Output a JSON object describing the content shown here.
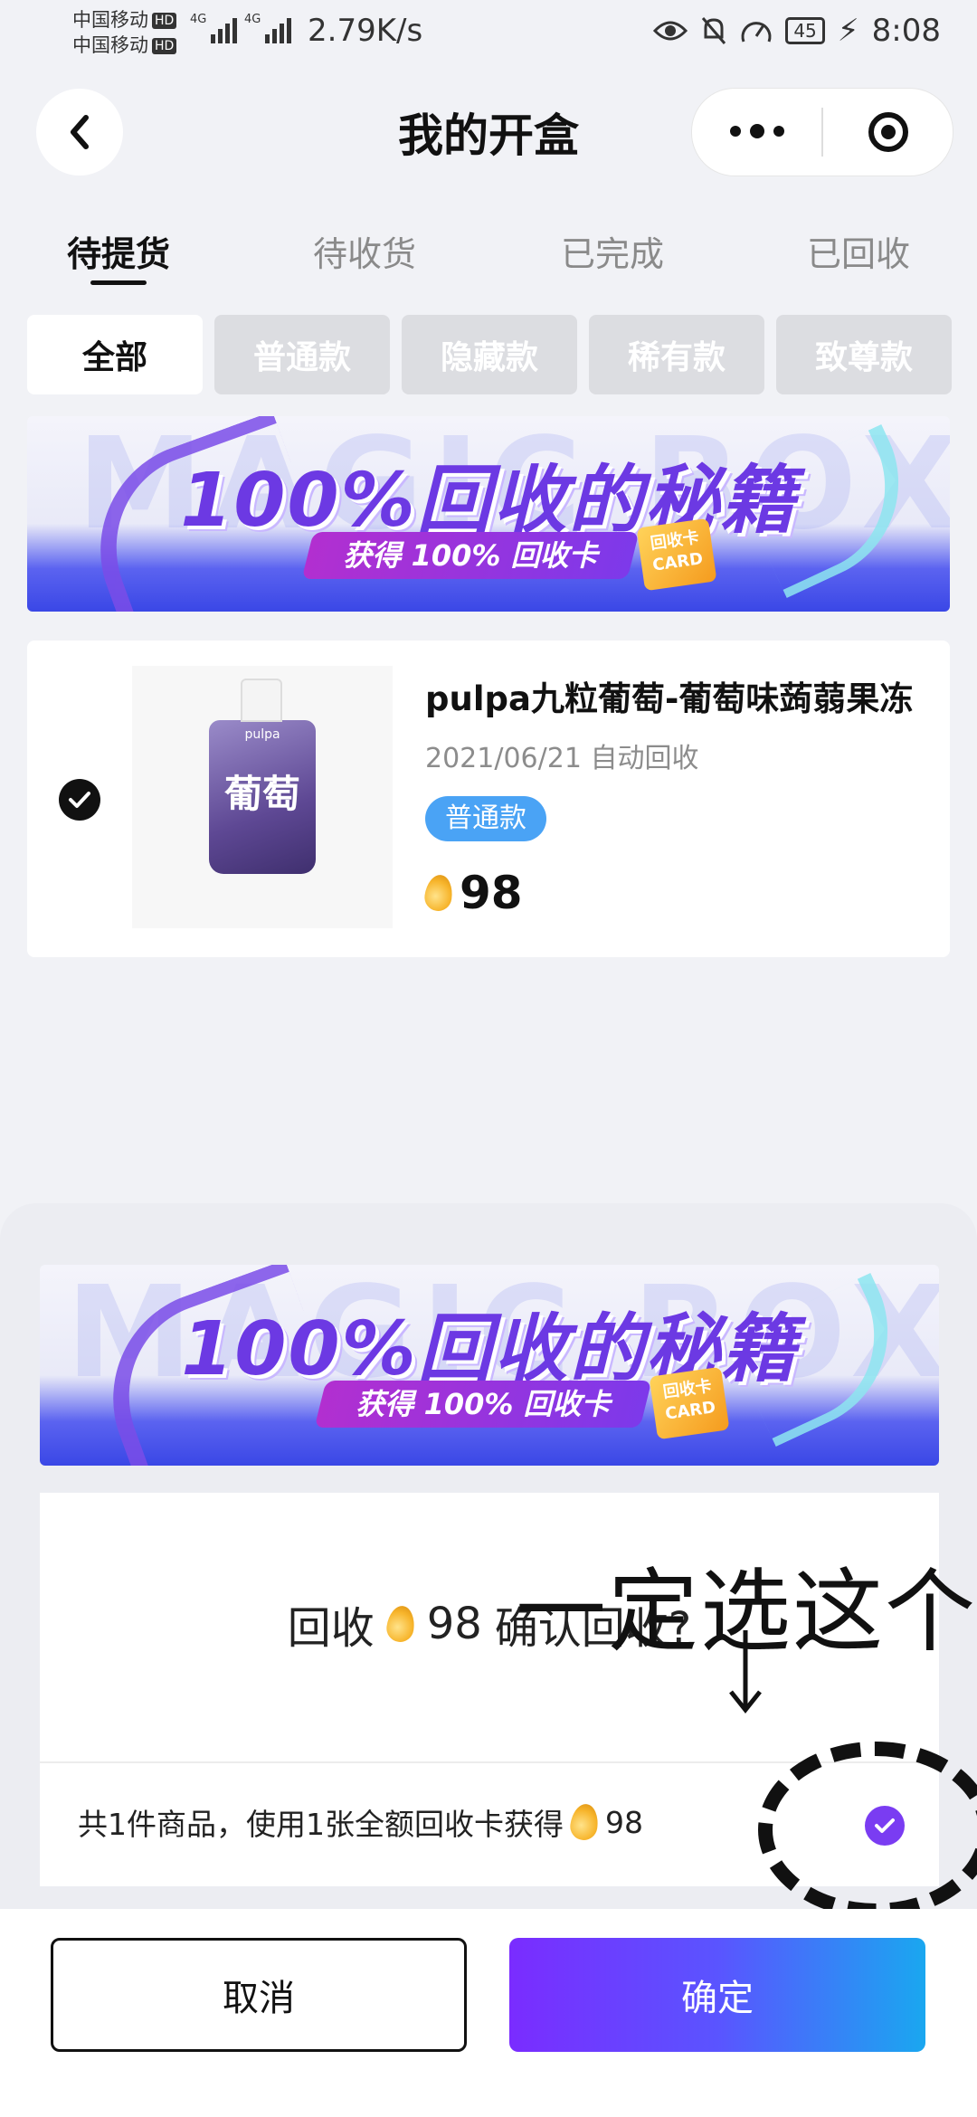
{
  "status_bar": {
    "carrier_1": "中国移动",
    "carrier_2": "中国移动",
    "hd_badge": "HD",
    "network_gen": "4G",
    "net_speed": "2.79K/s",
    "battery": "45",
    "time": "8:08"
  },
  "header": {
    "title": "我的开盒"
  },
  "tabs": [
    {
      "label": "待提货",
      "active": true
    },
    {
      "label": "待收货",
      "active": false
    },
    {
      "label": "已完成",
      "active": false
    },
    {
      "label": "已回收",
      "active": false
    }
  ],
  "filters": [
    {
      "label": "全部",
      "active": true
    },
    {
      "label": "普通款",
      "active": false
    },
    {
      "label": "隐藏款",
      "active": false
    },
    {
      "label": "稀有款",
      "active": false
    },
    {
      "label": "致尊款",
      "active": false
    }
  ],
  "banner": {
    "headline": "100%回收的秘籍",
    "ribbon": "获得 100% 回收卡",
    "badge_line1": "回收卡",
    "badge_line2": "CARD",
    "watermark": "MAGIC BOX"
  },
  "product": {
    "name": "pulpa九粒葡萄-葡萄味蒟蒻果冻",
    "date": "2021/06/21 自动回收",
    "tag": "普通款",
    "price": "98",
    "image_brand": "pulpa",
    "image_text": "葡萄",
    "selected": true
  },
  "dialog": {
    "message_prefix": "回收",
    "message_amount": "98",
    "message_suffix": "确认回收?",
    "summary_prefix": "共1件商品，使用1张全额回收卡获得",
    "summary_amount": "98",
    "card_checked": true,
    "annotation": "一定选这个",
    "cancel_label": "取消",
    "confirm_label": "确定"
  },
  "colors": {
    "accent_purple": "#7a3cf2",
    "tag_blue": "#4aa3f5",
    "confirm_gradient_start": "#7a2cff",
    "confirm_gradient_end": "#1aa7f0"
  }
}
